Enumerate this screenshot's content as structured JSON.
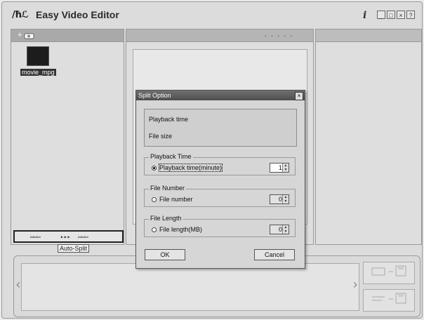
{
  "app": {
    "logo_text": "/ħℒ",
    "title": "Easy Video Editor",
    "info_icon": "i",
    "window_buttons": [
      "_",
      "□",
      "×",
      "?"
    ]
  },
  "library": {
    "add_icon": "+",
    "items": [
      {
        "label": "movie_mpg"
      }
    ]
  },
  "auto_split": {
    "label": "Auto-Split",
    "arrows": "▸▸▸"
  },
  "timeline": {
    "left_arrow": "‹",
    "right_arrow": "›"
  },
  "dialog": {
    "title": "Split Option",
    "close": "×",
    "info": {
      "line1": "Playback time",
      "line2": "File size"
    },
    "groups": [
      {
        "title": "Playback Time",
        "option": "Playback time(minute)",
        "value": "1",
        "selected": true
      },
      {
        "title": "File Number",
        "option": "File number",
        "value": "0",
        "selected": false
      },
      {
        "title": "File Length",
        "option": "File length(MB)",
        "value": "0",
        "selected": false
      }
    ],
    "ok_label": "OK",
    "cancel_label": "Cancel"
  }
}
